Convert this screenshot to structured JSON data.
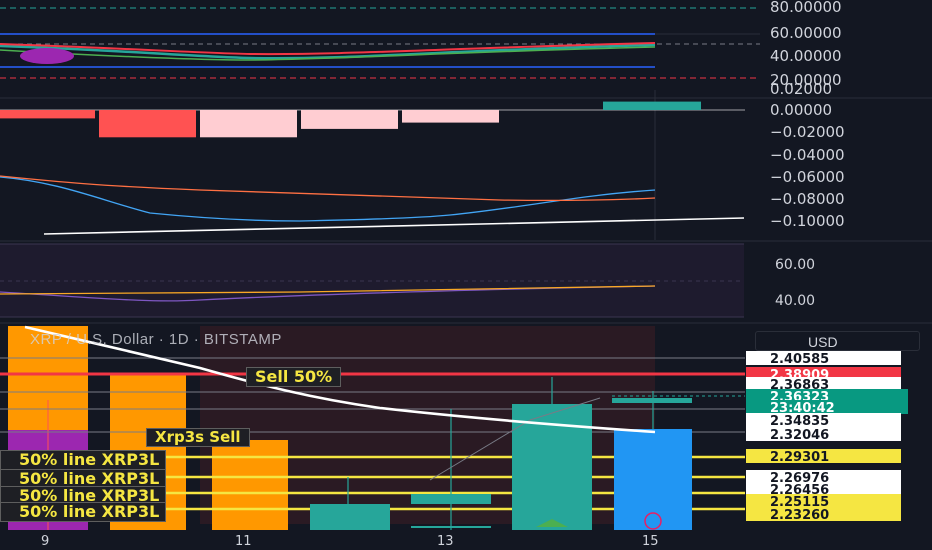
{
  "header": {
    "symbol_title": "XRP / U.S. Dollar · 1D · BITSTAMP",
    "currency_button": "USD"
  },
  "colors": {
    "bg": "#131722",
    "up": "#26a69a",
    "up_bar_blue": "#2196f3",
    "down": "#ff5252",
    "down_light": "#ffcdd2",
    "orange": "#ff9800",
    "purple": "#9c27b0",
    "yellow": "#f5e642",
    "sell_red": "#f23645"
  },
  "chart_data": [
    {
      "type": "line",
      "name": "upper-oscillator",
      "axis_ticks": [
        "80.00000",
        "60.00000",
        "40.00000",
        "20.00000"
      ],
      "ylim": [
        20,
        80
      ]
    },
    {
      "type": "bar",
      "name": "histogram",
      "axis_ticks": [
        "0.02000",
        "0.00000",
        "−0.02000",
        "−0.04000",
        "−0.06000",
        "−0.08000",
        "−0.10000"
      ],
      "ylim": [
        -0.1,
        0.02
      ],
      "values": [
        -0.004,
        -0.013,
        -0.013,
        -0.009,
        -0.006,
        0.004
      ]
    },
    {
      "type": "line",
      "name": "third-oscillator",
      "axis_ticks": [
        "60.00",
        "40.00"
      ],
      "ylim": [
        35,
        65
      ]
    },
    {
      "type": "bar",
      "name": "price",
      "x_ticks": [
        "9",
        "11",
        "13",
        "15"
      ],
      "price_labels": [
        {
          "text": "2.40585",
          "style": "white"
        },
        {
          "text": "2.38909",
          "style": "red"
        },
        {
          "text": "2.36863",
          "style": "white"
        },
        {
          "text": "2.36323",
          "style": "green"
        },
        {
          "text": "23:40:42",
          "style": "green"
        },
        {
          "text": "2.34835",
          "style": "white"
        },
        {
          "text": "2.32046",
          "style": "white"
        },
        {
          "text": "2.29301",
          "style": "yellow"
        },
        {
          "text": "2.26976",
          "style": "white"
        },
        {
          "text": "2.26456",
          "style": "white"
        },
        {
          "text": "2.25115",
          "style": "yellow"
        },
        {
          "text": "2.23260",
          "style": "yellow"
        }
      ],
      "annotations": [
        "Sell 50%",
        "Xrp3s Sell",
        "50% line XRP3L",
        "50% line XRP3L",
        "50% line XRP3L",
        "50% line XRP3L"
      ]
    }
  ]
}
